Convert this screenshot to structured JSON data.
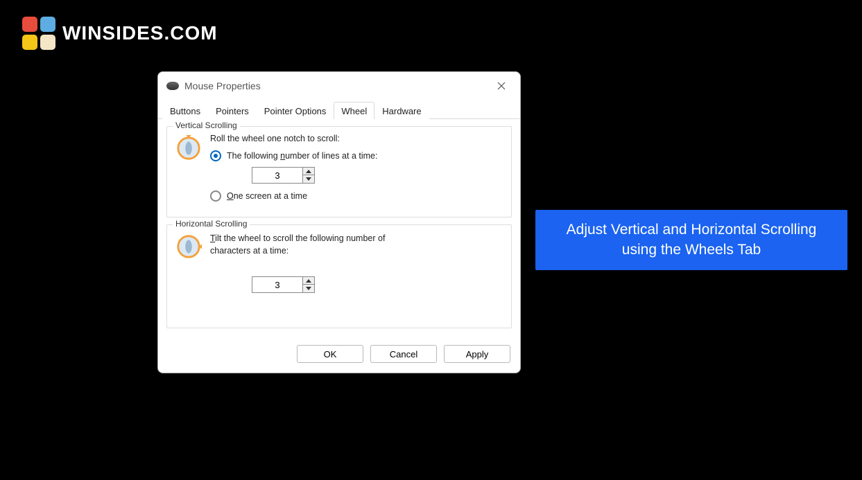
{
  "logo": {
    "text": "WINSIDES.COM"
  },
  "callout": {
    "line1": "Adjust Vertical and Horizontal Scrolling",
    "line2": "using the Wheels Tab"
  },
  "dialog": {
    "title": "Mouse Properties",
    "tabs": [
      "Buttons",
      "Pointers",
      "Pointer Options",
      "Wheel",
      "Hardware"
    ],
    "active_tab_index": 3,
    "vertical_group": {
      "title": "Vertical Scrolling",
      "prompt": "Roll the wheel one notch to scroll:",
      "radio_lines_prefix": "The following ",
      "radio_lines_uchar": "n",
      "radio_lines_suffix": "umber of lines at a time:",
      "radio_screen_uchar": "O",
      "radio_screen_rest": "ne screen at a time",
      "lines_value": "3",
      "selected": "lines"
    },
    "horizontal_group": {
      "title": "Horizontal Scrolling",
      "prompt_uchar": "T",
      "prompt_rest": "ilt the wheel to scroll the following number of characters at a time:",
      "chars_value": "3"
    },
    "buttons": {
      "ok": "OK",
      "cancel": "Cancel",
      "apply": "Apply"
    }
  }
}
